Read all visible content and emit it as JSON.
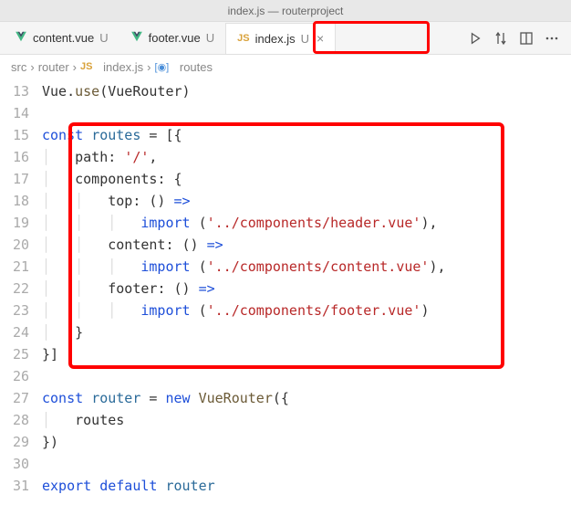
{
  "titlebar": "index.js — routerproject",
  "tabs": [
    {
      "label": "content.vue",
      "status": "U",
      "icon": "vue"
    },
    {
      "label": "footer.vue",
      "status": "U",
      "icon": "vue"
    },
    {
      "label": "index.js",
      "status": "U",
      "icon": "js",
      "active": true
    }
  ],
  "breadcrumb": {
    "parts": [
      "src",
      "router",
      "index.js",
      "routes"
    ],
    "sep": "›"
  },
  "lines": {
    "13": {
      "tokens": [
        [
          "plain",
          "Vue"
        ],
        [
          "punc",
          "."
        ],
        [
          "fn",
          "use"
        ],
        [
          "punc",
          "("
        ],
        [
          "plain",
          "VueRouter"
        ],
        [
          "punc",
          ")"
        ]
      ]
    },
    "14": {
      "tokens": []
    },
    "15": {
      "tokens": [
        [
          "kw",
          "const"
        ],
        [
          "plain",
          " "
        ],
        [
          "ident",
          "routes"
        ],
        [
          "plain",
          " "
        ],
        [
          "punc",
          "="
        ],
        [
          "plain",
          " "
        ],
        [
          "punc",
          "[{"
        ]
      ]
    },
    "16": {
      "indent": 1,
      "tokens": [
        [
          "plain",
          "path"
        ],
        [
          "punc",
          ":"
        ],
        [
          "plain",
          " "
        ],
        [
          "str",
          "'/'"
        ],
        [
          "punc",
          ","
        ]
      ]
    },
    "17": {
      "indent": 1,
      "tokens": [
        [
          "plain",
          "components"
        ],
        [
          "punc",
          ":"
        ],
        [
          "plain",
          " "
        ],
        [
          "punc",
          "{"
        ]
      ]
    },
    "18": {
      "indent": 2,
      "tokens": [
        [
          "plain",
          "top"
        ],
        [
          "punc",
          ":"
        ],
        [
          "plain",
          " "
        ],
        [
          "punc",
          "()"
        ],
        [
          "plain",
          " "
        ],
        [
          "op",
          "=>"
        ]
      ]
    },
    "19": {
      "indent": 3,
      "tokens": [
        [
          "kw",
          "import"
        ],
        [
          "plain",
          " "
        ],
        [
          "punc",
          "("
        ],
        [
          "str",
          "'../components/header.vue'"
        ],
        [
          "punc",
          "),"
        ]
      ]
    },
    "20": {
      "indent": 2,
      "tokens": [
        [
          "plain",
          "content"
        ],
        [
          "punc",
          ":"
        ],
        [
          "plain",
          " "
        ],
        [
          "punc",
          "()"
        ],
        [
          "plain",
          " "
        ],
        [
          "op",
          "=>"
        ]
      ]
    },
    "21": {
      "indent": 3,
      "tokens": [
        [
          "kw",
          "import"
        ],
        [
          "plain",
          " "
        ],
        [
          "punc",
          "("
        ],
        [
          "str",
          "'../components/content.vue'"
        ],
        [
          "punc",
          "),"
        ]
      ]
    },
    "22": {
      "indent": 2,
      "tokens": [
        [
          "plain",
          "footer"
        ],
        [
          "punc",
          ":"
        ],
        [
          "plain",
          " "
        ],
        [
          "punc",
          "()"
        ],
        [
          "plain",
          " "
        ],
        [
          "op",
          "=>"
        ]
      ]
    },
    "23": {
      "indent": 3,
      "tokens": [
        [
          "kw",
          "import"
        ],
        [
          "plain",
          " "
        ],
        [
          "punc",
          "("
        ],
        [
          "str",
          "'../components/footer.vue'"
        ],
        [
          "punc",
          ")"
        ]
      ]
    },
    "24": {
      "indent": 1,
      "tokens": [
        [
          "punc",
          "}"
        ]
      ]
    },
    "25": {
      "tokens": [
        [
          "punc",
          "}]"
        ]
      ]
    },
    "26": {
      "tokens": []
    },
    "27": {
      "tokens": [
        [
          "kw",
          "const"
        ],
        [
          "plain",
          " "
        ],
        [
          "ident",
          "router"
        ],
        [
          "plain",
          " "
        ],
        [
          "punc",
          "="
        ],
        [
          "plain",
          " "
        ],
        [
          "kw",
          "new"
        ],
        [
          "plain",
          " "
        ],
        [
          "fn",
          "VueRouter"
        ],
        [
          "punc",
          "({"
        ]
      ]
    },
    "28": {
      "indent": 1,
      "tokens": [
        [
          "plain",
          "routes"
        ]
      ]
    },
    "29": {
      "tokens": [
        [
          "punc",
          "})"
        ]
      ]
    },
    "30": {
      "tokens": []
    },
    "31": {
      "tokens": [
        [
          "kw",
          "export"
        ],
        [
          "plain",
          " "
        ],
        [
          "kw",
          "default"
        ],
        [
          "plain",
          " "
        ],
        [
          "ident",
          "router"
        ]
      ]
    }
  },
  "lineNumbers": [
    "13",
    "14",
    "15",
    "16",
    "17",
    "18",
    "19",
    "20",
    "21",
    "22",
    "23",
    "24",
    "25",
    "26",
    "27",
    "28",
    "29",
    "30",
    "31"
  ],
  "icons": {
    "js": "JS"
  }
}
